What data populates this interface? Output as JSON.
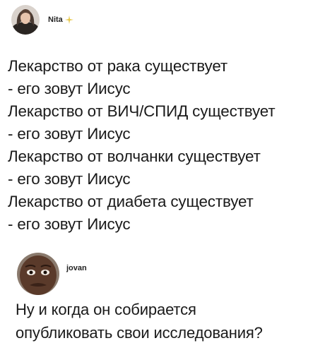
{
  "posts": [
    {
      "author": "Nita",
      "author_badge_icon": "sparkle-icon",
      "lines": [
        "Лекарство от рака существует",
        "- его зовут Иисус",
        "Лекарство от ВИЧ/СПИД существует",
        "- его зовут Иисус",
        "Лекарство от волчанки существует",
        "- его зовут Иисус",
        "Лекарство от диабета существует",
        "- его зовут Иисус"
      ]
    },
    {
      "author": "jovan",
      "lines": [
        "Ну и когда он собирается",
        "опубликовать свои исследования?"
      ]
    }
  ],
  "colors": {
    "text": "#1a1a1a",
    "badge": "#e7c84a"
  }
}
